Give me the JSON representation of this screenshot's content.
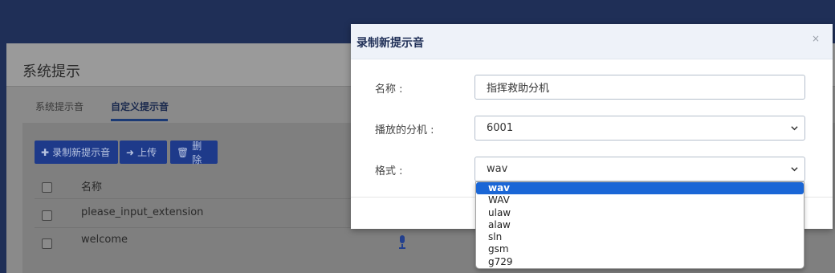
{
  "background": {
    "title": "系统提示",
    "tabs": [
      {
        "label": "系统提示音",
        "active": false
      },
      {
        "label": "自定义提示音",
        "active": true
      }
    ],
    "toolbar": {
      "record_label": "录制新提示音",
      "upload_label": "上传",
      "delete_label": "删除"
    },
    "table": {
      "header_name": "名称",
      "rows": [
        "please_input_extension",
        "welcome"
      ]
    }
  },
  "modal": {
    "title": "录制新提示音",
    "close": "×",
    "fields": {
      "name_label": "名称 :",
      "name_value": "指挥救助分机",
      "extension_label": "播放的分机 :",
      "extension_value": "6001",
      "format_label": "格式 :",
      "format_value": "wav"
    }
  },
  "format_dropdown": {
    "options": [
      "wav",
      "WAV",
      "ulaw",
      "alaw",
      "sln",
      "gsm",
      "g729"
    ],
    "selected": "wav"
  },
  "colors": {
    "accent": "#1e3a8a",
    "selected_option": "#1a66d6",
    "topbar": "#1f2f57"
  },
  "icons": {
    "record": "plus-icon",
    "upload": "sign-in-icon",
    "delete": "trash-icon",
    "mic": "microphone-icon",
    "select": "chevron-down-icon"
  }
}
